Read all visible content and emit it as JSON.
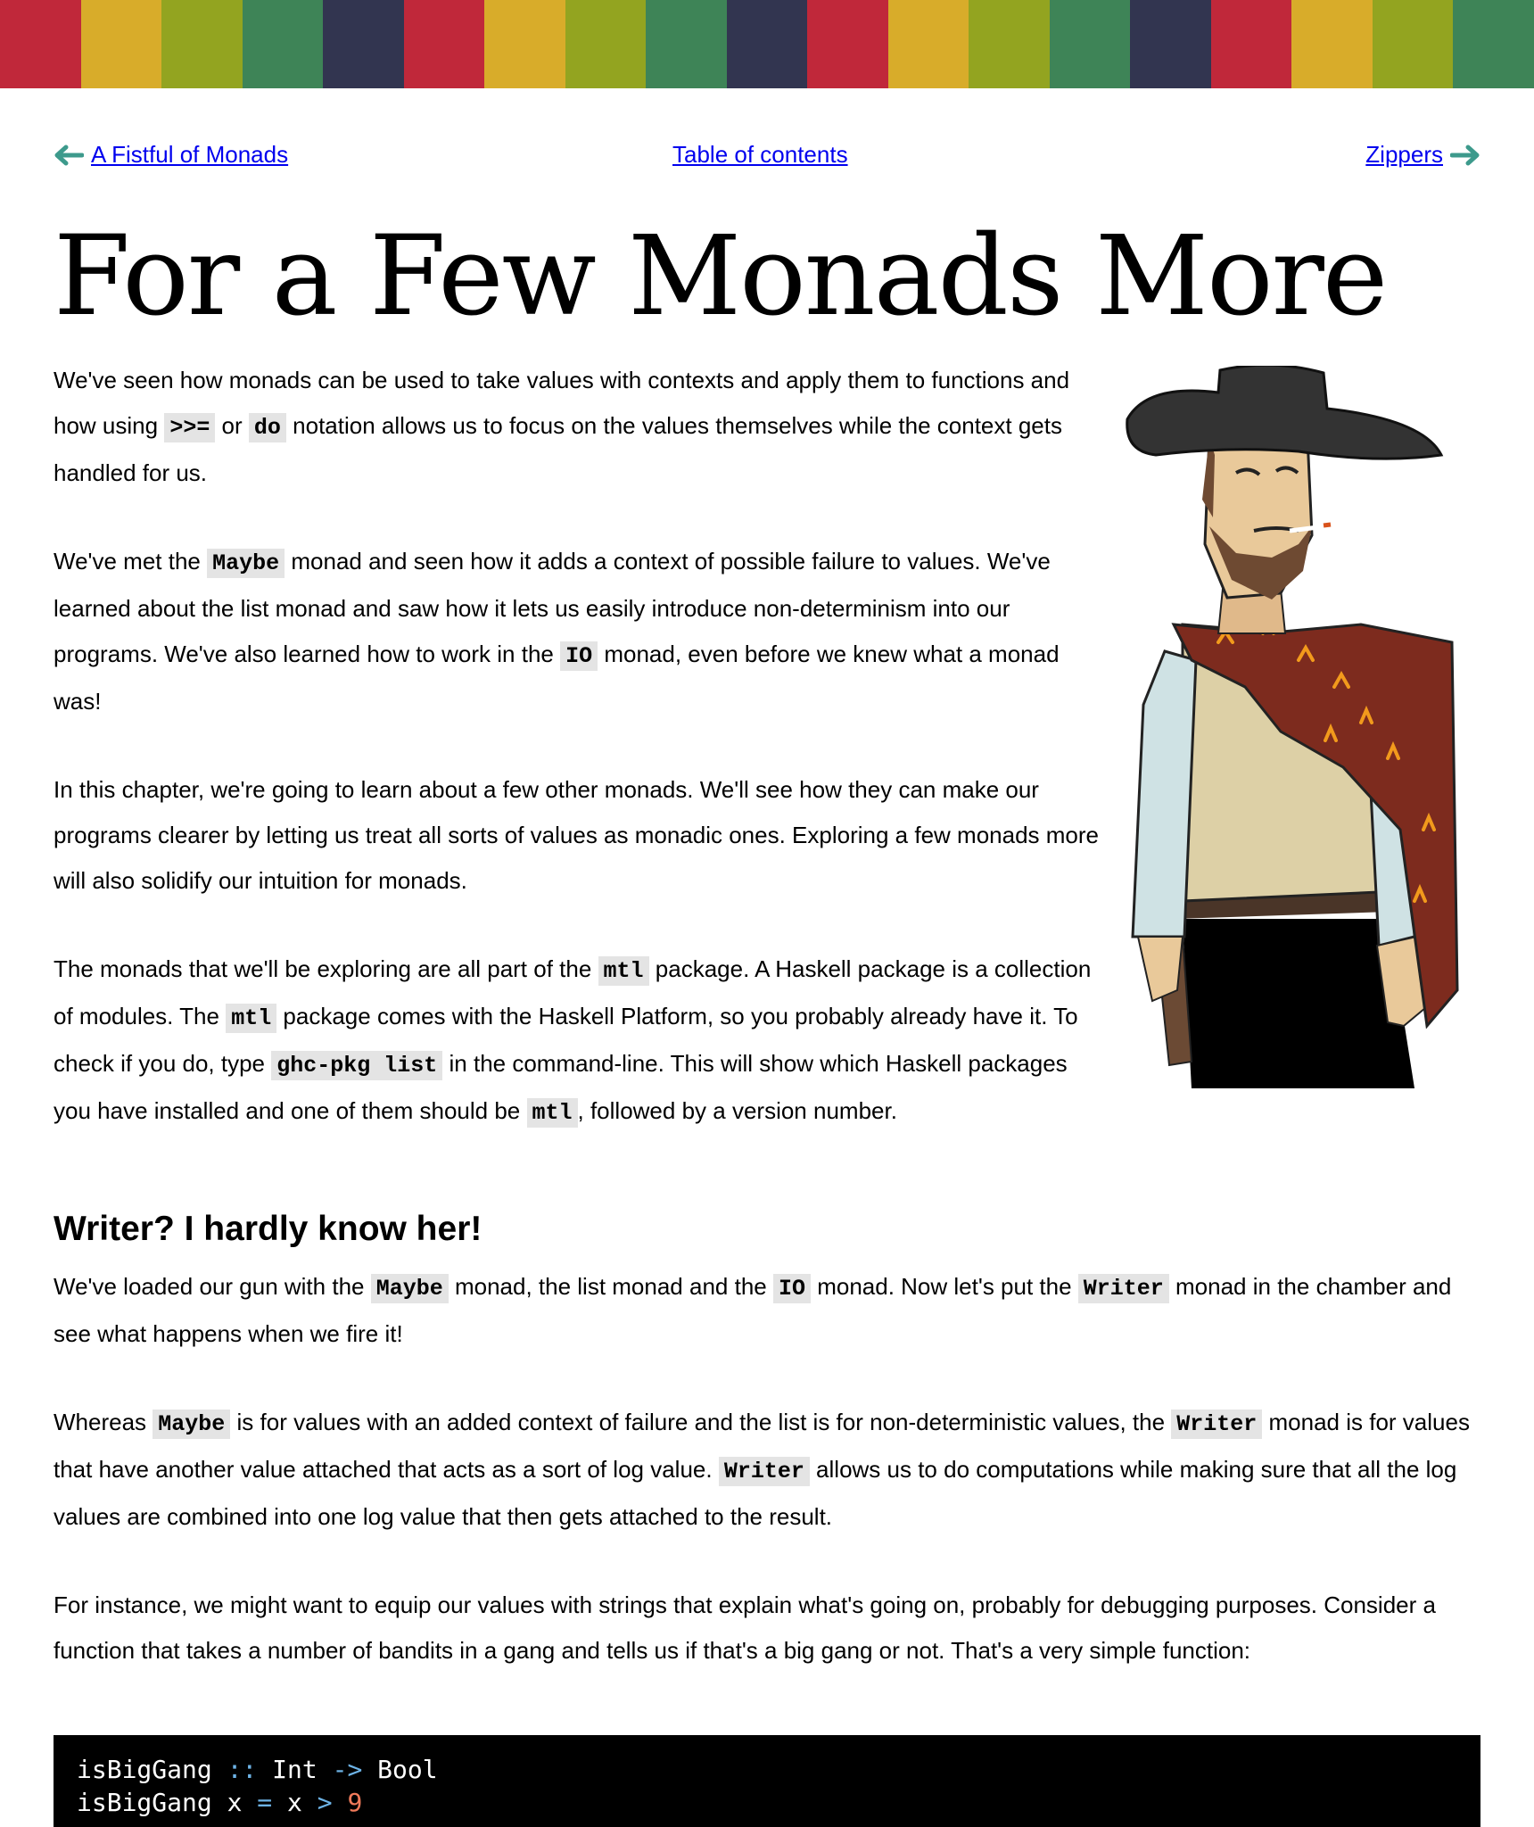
{
  "colors": {
    "stripe": [
      "#c0283a",
      "#d8ac2a",
      "#93a420",
      "#3e8457",
      "#323550",
      "#c0283a",
      "#d8ac2a",
      "#93a420",
      "#3e8457",
      "#323550",
      "#c0283a",
      "#d8ac2a",
      "#93a420",
      "#3e8457",
      "#323550",
      "#c0283a",
      "#d8ac2a",
      "#93a420",
      "#3e8457"
    ],
    "link": "#0000ee",
    "arrow": "#3d9a8c",
    "code_bg": "#e4e4e4"
  },
  "nav": {
    "prev_label": "A Fistful of Monads",
    "toc_label": "Table of contents",
    "next_label": "Zippers"
  },
  "page_title": "For a Few Monads More",
  "intro": {
    "p1": {
      "a": "We've seen how monads can be used to take values with contexts and apply them to functions and how using ",
      "code1": ">>=",
      "b": " or ",
      "code2": "do",
      "c": " notation allows us to focus on the values themselves while the context gets handled for us."
    },
    "p2": {
      "a": "We've met the ",
      "code1": "Maybe",
      "b": " monad and seen how it adds a context of possible failure to values. We've learned about the list monad and saw how it lets us easily introduce non-determinism into our programs. We've also learned how to work in the ",
      "code2": "IO",
      "c": " monad, even before we knew what a monad was!"
    },
    "p3": "In this chapter, we're going to learn about a few other monads. We'll see how they can make our programs clearer by letting us treat all sorts of values as monadic ones. Exploring a few monads more will also solidify our intuition for monads.",
    "p4": {
      "a": "The monads that we'll be exploring are all part of the ",
      "code1": "mtl",
      "b": " package. A Haskell package is a collection of modules. The ",
      "code2": "mtl",
      "c": " package comes with the Haskell Platform, so you probably already have it. To check if you do, type ",
      "code3": "ghc-pkg list",
      "d": " in the command-line. This will show which Haskell packages you have installed and one of them should be ",
      "code4": "mtl",
      "e": ", followed by a version number."
    }
  },
  "section": {
    "heading": "Writer? I hardly know her!",
    "p1": {
      "a": "We've loaded our gun with the ",
      "code1": "Maybe",
      "b": " monad, the list monad and the ",
      "code2": "IO",
      "c": " monad. Now let's put the ",
      "code3": "Writer",
      "d": " monad in the chamber and see what happens when we fire it!"
    },
    "p2": {
      "a": "Whereas ",
      "code1": "Maybe",
      "b": " is for values with an added context of failure and the list is for non-deterministic values, the ",
      "code2": "Writer",
      "c": " monad is for values that have another value attached that acts as a sort of log value. ",
      "code3": "Writer",
      "d": " allows us to do computations while making sure that all the log values are combined into one log value that then gets attached to the result."
    },
    "p3": "For instance, we might want to equip our values with strings that explain what's going on, probably for debugging purposes. Consider a function that takes a number of bandits in a gang and tells us if that's a big gang or not. That's a very simple function:"
  },
  "code": {
    "l1": {
      "name": "isBigGang",
      "sig": "::",
      "t1": "Int",
      "arrow": "->",
      "t2": "Bool"
    },
    "l2": {
      "name": "isBigGang",
      "arg": "x",
      "eq": "=",
      "x": "x",
      "gt": ">",
      "num": "9"
    }
  }
}
